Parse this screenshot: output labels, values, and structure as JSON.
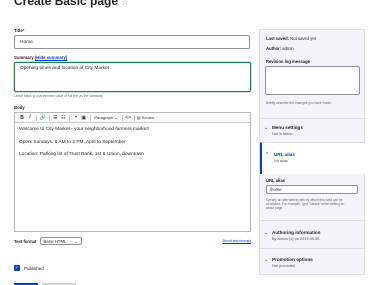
{
  "page": {
    "title": "Create Basic page",
    "star": "☆"
  },
  "title_field": {
    "label": "Title",
    "required": "*",
    "value": "Home"
  },
  "summary": {
    "label": "Summary",
    "hide_link": "(Hide summary)",
    "value": "Opening times and location of City Market",
    "description": "Leave blank to use trimmed value of full text as the summary."
  },
  "body_field": {
    "label": "Body",
    "toolbar": {
      "bold": "B",
      "italic": "I",
      "link": "🔗",
      "bullets": "☰",
      "numbers": "☷",
      "quote": "❝",
      "image": "▣",
      "paragraph": "Paragraph",
      "code": "<>",
      "source": "Source"
    },
    "paragraphs": [
      "Welcome to City Market - your neighborhood farmers market!",
      "Open: Sundays, 9 AM to 2 PM, April to September",
      "Location: Parking lot of Trust Bank, 1st & Union, downtown"
    ]
  },
  "text_format": {
    "label": "Text format",
    "value": "Basic HTML",
    "about": "About text formats"
  },
  "published": {
    "label": "Published",
    "checked": true
  },
  "sidebar": {
    "last_saved_label": "Last saved:",
    "last_saved_value": "Not saved yet",
    "author_label": "Author:",
    "author_value": "admin",
    "revision_label": "Revision log message",
    "revision_desc": "Briefly describe the changes you have made.",
    "menu_settings": {
      "title": "Menu settings",
      "sub": "Not in menu"
    },
    "url_alias": {
      "title": "URL alias",
      "sub": "No alias",
      "field_label": "URL alias",
      "field_value": "/home",
      "desc_lines": [
        "Specify an alternative path by which this data can be",
        "accessed. For example, type \"/about\" when writing an",
        "about page."
      ]
    },
    "authoring": {
      "title": "Authoring information",
      "sub": "By admin (1) on 2019-08-30"
    },
    "promotion": {
      "title": "Promotion options",
      "sub": "Not promoted"
    }
  }
}
